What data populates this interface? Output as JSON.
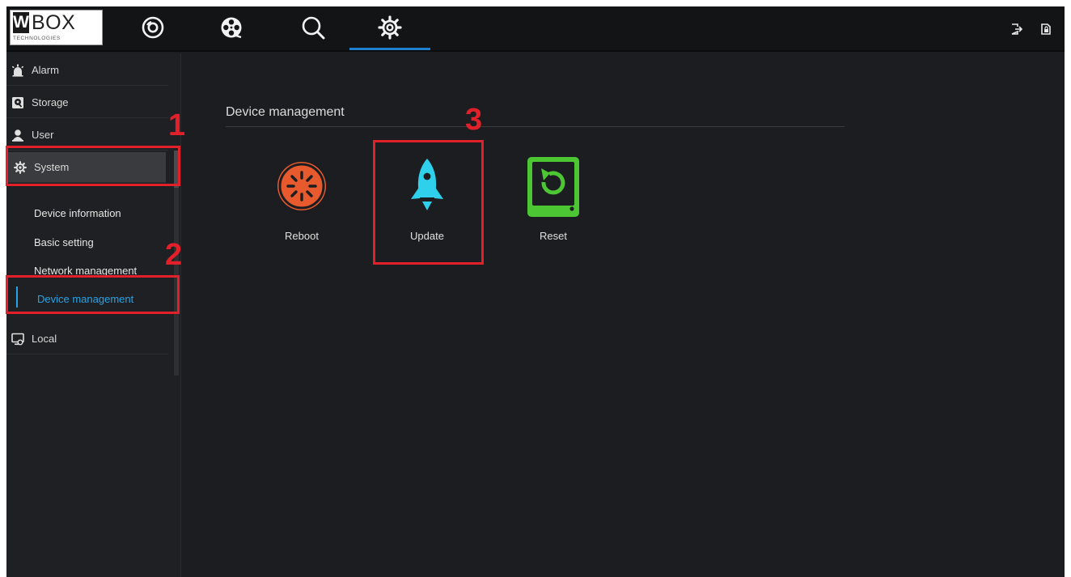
{
  "logo": {
    "w": "W",
    "box": "BOX",
    "tech": "TECHNOLOGIES"
  },
  "topnav": [
    "live-view-icon",
    "playback-icon",
    "search-icon",
    "settings-icon"
  ],
  "active_nav": "settings-icon",
  "top_right": [
    "logout-icon",
    "lock-icon"
  ],
  "sidebar": {
    "items": [
      {
        "label": "Alarm",
        "icon": "alarm-icon"
      },
      {
        "label": "Storage",
        "icon": "storage-icon"
      },
      {
        "label": "User",
        "icon": "user-icon"
      },
      {
        "label": "System",
        "icon": "gear-icon",
        "selected": true
      },
      {
        "label": "Local",
        "icon": "local-icon"
      }
    ],
    "system_sub": [
      {
        "label": "Device information"
      },
      {
        "label": "Basic setting"
      },
      {
        "label": "Network management"
      },
      {
        "label": "Device management",
        "active": true
      }
    ]
  },
  "main": {
    "title": "Device management",
    "actions": [
      {
        "label": "Reboot",
        "color": "#e65a2e"
      },
      {
        "label": "Update",
        "color": "#2ed0ec"
      },
      {
        "label": "Reset",
        "color": "#4cc733"
      }
    ]
  },
  "annotations": [
    "1",
    "2",
    "3"
  ],
  "colors": {
    "accent": "#29a3e6",
    "nav_active": "#1e7fd0",
    "annotation": "#e1202a",
    "background": "#1c1d20"
  }
}
